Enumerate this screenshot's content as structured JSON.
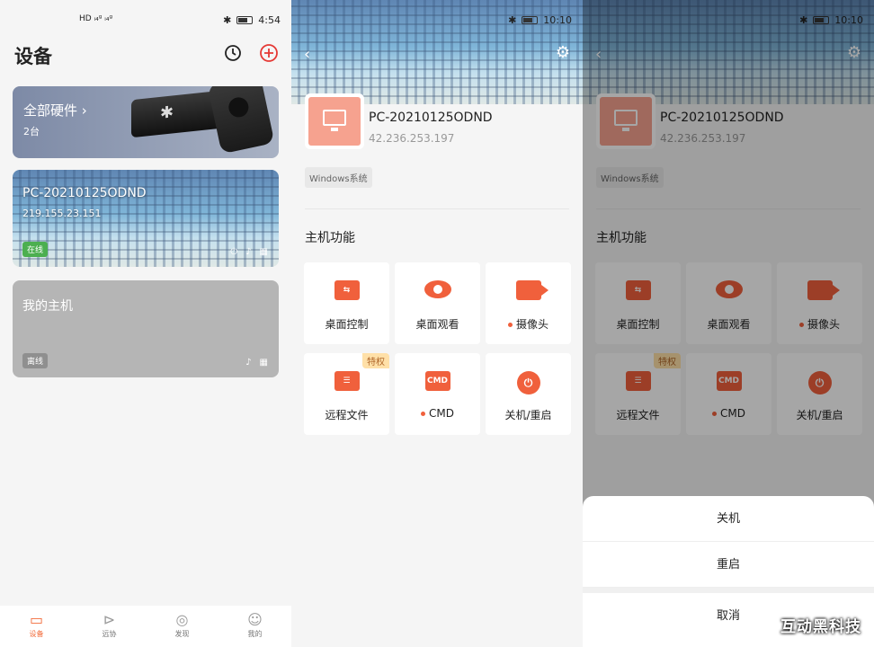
{
  "s1": {
    "status": {
      "left": "HD ᵢ₄ᶢ ᵢ₄ᶢ",
      "time": "4:54"
    },
    "title": "设备",
    "hardware": {
      "title": "全部硬件",
      "chevron": "›",
      "count": "2台"
    },
    "pc": {
      "name": "PC-20210125ODND",
      "ip": "219.155.23.151",
      "status": "在线"
    },
    "my": {
      "name": "我的主机",
      "status": "离线"
    },
    "icons": {
      "history": "history-icon",
      "add": "plus-circle-icon"
    },
    "tabs": [
      {
        "label": "设备",
        "icon": "▭"
      },
      {
        "label": "远协",
        "icon": "⊳"
      },
      {
        "label": "发现",
        "icon": "◎"
      },
      {
        "label": "我的",
        "icon": "☺"
      }
    ]
  },
  "s2": {
    "time": "10:10",
    "pc_name": "PC-20210125ODND",
    "pc_ip": "42.236.253.197",
    "os": "Windows系统",
    "section": "主机功能",
    "functions": [
      {
        "label": "桌面控制",
        "dot": false,
        "icon": "desktop-control-icon",
        "glyph": "⇆"
      },
      {
        "label": "桌面观看",
        "dot": false,
        "icon": "eye-icon",
        "glyph": ""
      },
      {
        "label": "摄像头",
        "dot": true,
        "icon": "camera-icon",
        "glyph": ""
      },
      {
        "label": "远程文件",
        "dot": false,
        "icon": "folder-icon",
        "glyph": "☰",
        "vip": "特权"
      },
      {
        "label": "CMD",
        "dot": true,
        "icon": "cmd-icon",
        "glyph": "CMD"
      },
      {
        "label": "关机/重启",
        "dot": false,
        "icon": "power-icon",
        "glyph": "⏻"
      }
    ]
  },
  "s3": {
    "sheet": {
      "shutdown": "关机",
      "restart": "重启",
      "cancel": "取消"
    },
    "watermark": "互动黑科技"
  },
  "colors": {
    "accent": "#f0603c",
    "online": "#4caf50"
  }
}
